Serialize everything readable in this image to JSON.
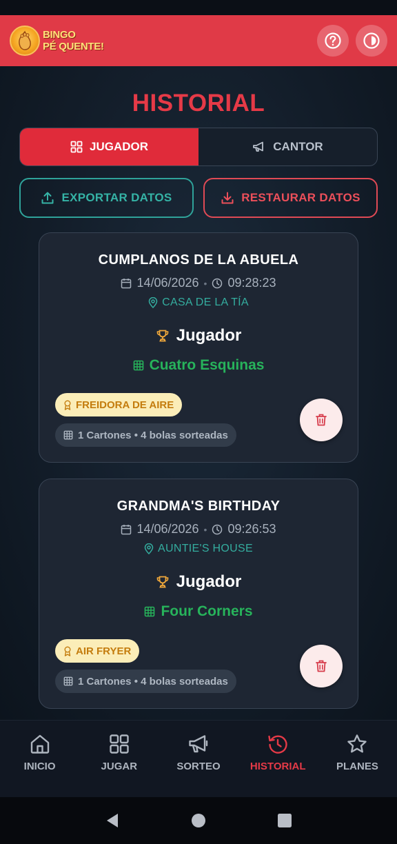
{
  "header": {
    "logo_line1": "BINGO",
    "logo_line2": "PÉ QUENTE!",
    "help_icon": "question-circle-icon",
    "power_icon": "power-icon",
    "brand_color": "#e03a47"
  },
  "page": {
    "title": "HISTORIAL"
  },
  "tabs": [
    {
      "label": "JUGADOR",
      "icon": "grid-icon",
      "active": true
    },
    {
      "label": "CANTOR",
      "icon": "megaphone-icon",
      "active": false
    }
  ],
  "actions": {
    "export_label": "EXPORTAR DATOS",
    "restore_label": "RESTAURAR DATOS"
  },
  "cards": [
    {
      "title": "CUMPLANOS DE LA ABUELA",
      "date": "14/06/2026",
      "time": "09:28:23",
      "location": "CASA DE LA TÍA",
      "role": "Jugador",
      "pattern": "Cuatro Esquinas",
      "prize": "FREIDORA DE AIRE",
      "stats": "1 Cartones • 4 bolas sorteadas"
    },
    {
      "title": "GRANDMA'S BIRTHDAY",
      "date": "14/06/2026",
      "time": "09:26:53",
      "location": "AUNTIE'S HOUSE",
      "role": "Jugador",
      "pattern": "Four Corners",
      "prize": "AIR FRYER",
      "stats": "1 Cartones • 4 bolas sorteadas"
    }
  ],
  "nav": [
    {
      "label": "INICIO",
      "icon": "home-icon",
      "active": false
    },
    {
      "label": "JUGAR",
      "icon": "grid-icon",
      "active": false
    },
    {
      "label": "SORTEO",
      "icon": "megaphone-icon",
      "active": false
    },
    {
      "label": "HISTORIAL",
      "icon": "history-icon",
      "active": true
    },
    {
      "label": "PLANES",
      "icon": "star-icon",
      "active": false
    }
  ],
  "meta_separator": "•"
}
